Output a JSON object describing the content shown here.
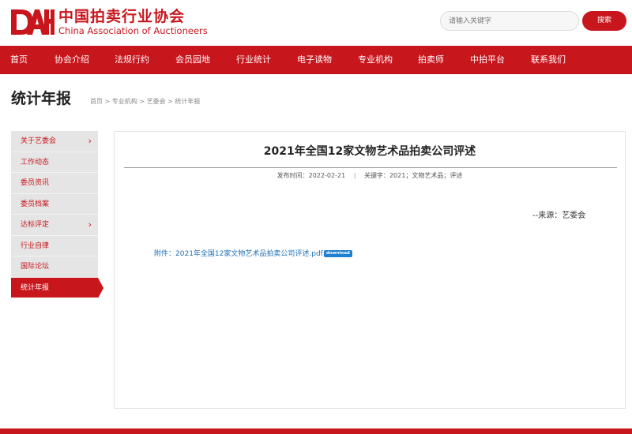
{
  "header": {
    "logo_cn": "中国拍卖行业协会",
    "logo_en": "China Association of Auctioneers",
    "search_placeholder": "请输入关键字",
    "search_button": "搜索",
    "brand_color": "#c8161d"
  },
  "nav": {
    "items": [
      "首页",
      "协会介绍",
      "法规行约",
      "会员园地",
      "行业统计",
      "电子读物",
      "专业机构",
      "拍卖师",
      "中拍平台",
      "联系我们"
    ]
  },
  "page": {
    "title": "统计年报",
    "breadcrumb": [
      "首页",
      "专业机构",
      "艺委会",
      "统计年报"
    ],
    "breadcrumb_sep": ">"
  },
  "sidebar": {
    "items": [
      {
        "label": "关于艺委会",
        "has_submenu": true
      },
      {
        "label": "工作动态",
        "has_submenu": false
      },
      {
        "label": "委员资讯",
        "has_submenu": false
      },
      {
        "label": "委员档案",
        "has_submenu": false
      },
      {
        "label": "达标评定",
        "has_submenu": true
      },
      {
        "label": "行业自律",
        "has_submenu": false
      },
      {
        "label": "国际论坛",
        "has_submenu": false
      },
      {
        "label": "统计年报",
        "has_submenu": false,
        "active": true
      }
    ]
  },
  "article": {
    "title": "2021年全国12家文物艺术品拍卖公司评述",
    "publish_label": "发布时间：",
    "publish_date": "2022-02-21",
    "meta_sep": "|",
    "keywords_label": "关键字：",
    "keywords": "2021；文物艺术品；评述",
    "source": "--来源：艺委会",
    "attachment_label": "附件：",
    "attachment_name": "2021年全国12家文物艺术品拍卖公司评述.pdf",
    "download_badge": "download"
  }
}
